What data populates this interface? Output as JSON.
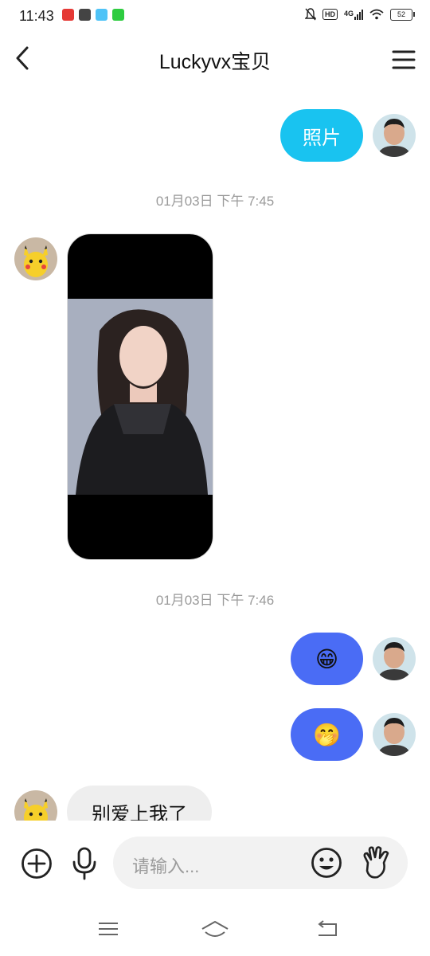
{
  "status_bar": {
    "time": "11:43",
    "network": "4G",
    "battery": "52"
  },
  "header": {
    "title": "Luckyvx宝贝"
  },
  "messages": {
    "photo_label": "照片",
    "timestamp_1": "01月03日  下午  7:45",
    "timestamp_2": "01月03日  下午  7:46",
    "emoji_1": "😁",
    "emoji_2": "🤭",
    "text_reply": "别爱上我了"
  },
  "input": {
    "placeholder": "请输入..."
  },
  "colors": {
    "sent_cyan": "#19c3f0",
    "sent_blue": "#4a6cf5",
    "received_gray": "#eeeeee"
  }
}
